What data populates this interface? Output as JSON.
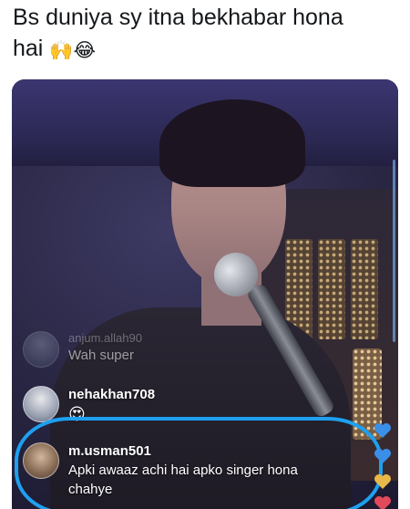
{
  "caption": {
    "line1": "Bs duniya sy itna bekhabar hona",
    "line2_text": "hai",
    "emojis": "🙌😂"
  },
  "comments": [
    {
      "username": "anjum.allah90",
      "message": "Wah super",
      "avatar": "user-avatar"
    },
    {
      "username": "nehakhan708",
      "message": "😍",
      "avatar": "user-avatar"
    },
    {
      "username": "m.usman501",
      "message": "Apki awaaz achi hai apko singer hona chahye",
      "avatar": "user-avatar"
    }
  ],
  "colors": {
    "highlight_ring": "#1ea0f0",
    "heart_blue": "#3a8fe8",
    "heart_yellow": "#e8b84a",
    "heart_red": "#e04a5a"
  },
  "icons": [
    "heart-icon"
  ]
}
